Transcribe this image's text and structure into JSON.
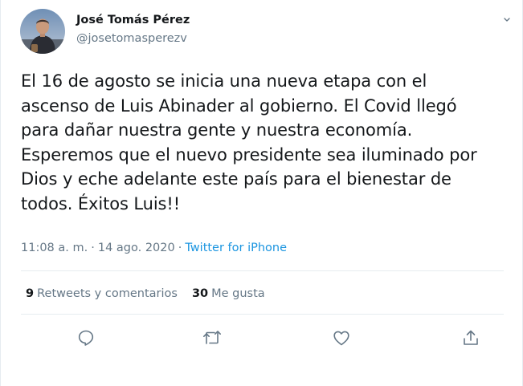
{
  "user": {
    "display_name": "José Tomás Pérez",
    "handle": "@josetomasperezv",
    "avatar_icon": "profile-photo"
  },
  "tweet": {
    "text": "El 16 de agosto se inicia una nueva etapa con el\nascenso de Luis Abinader al gobierno. El Covid llegó\npara dañar nuestra gente y nuestra economía.\nEsperemos que el nuevo presidente sea iluminado por\nDios y eche adelante este país para el bienestar de\ntodos. Éxitos Luis!!",
    "time": "11:08 a. m.",
    "separator1": "·",
    "date": "14 ago. 2020",
    "separator2": "·",
    "source": "Twitter for iPhone"
  },
  "stats": {
    "retweets_count": "9",
    "retweets_label": "Retweets y comentarios",
    "likes_count": "30",
    "likes_label": "Me gusta"
  },
  "actions": {
    "reply_icon": "reply-icon",
    "retweet_icon": "retweet-icon",
    "like_icon": "heart-icon",
    "share_icon": "share-icon"
  },
  "colors": {
    "text": "#14171a",
    "secondary": "#657786",
    "link": "#1b95e0",
    "divider": "#e6ecf0"
  }
}
